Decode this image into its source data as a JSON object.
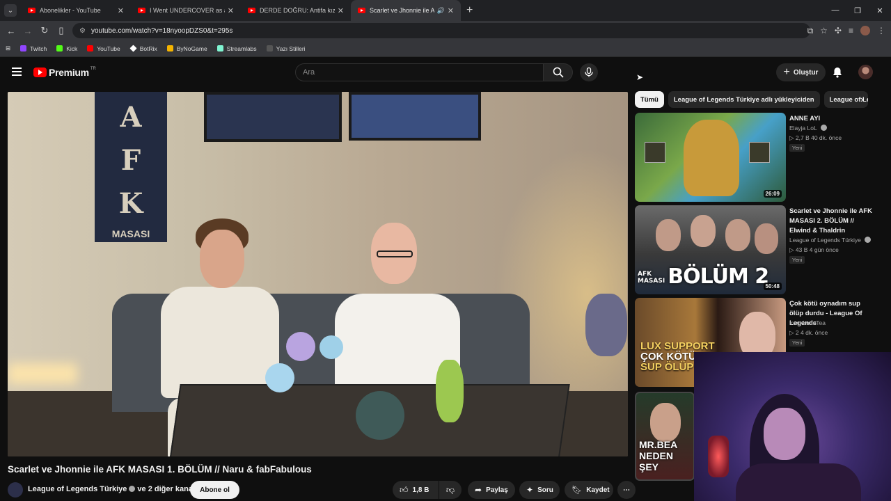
{
  "browser": {
    "tabs": [
      {
        "title": "Abonelikler - YouTube",
        "active": false
      },
      {
        "title": "I Went UNDERCOVER as a Low",
        "active": false
      },
      {
        "title": "DERDE DOĞRU: Antifa kız ve sö",
        "active": false
      },
      {
        "title": "Scarlet ve Jhonnie ile AFK M",
        "active": true
      }
    ],
    "url": "youtube.com/watch?v=18nyoopDZS0&t=295s",
    "bookmarks": [
      {
        "label": "Twitch",
        "color": "#9146ff"
      },
      {
        "label": "Kick",
        "color": "#53fc18"
      },
      {
        "label": "YouTube",
        "color": "#ff0000"
      },
      {
        "label": "BotRix",
        "color": "#ffffff"
      },
      {
        "label": "ByNoGame",
        "color": "#f5b400"
      },
      {
        "label": "Streamlabs",
        "color": "#80f5d2"
      },
      {
        "label": "Yazı Stilleri",
        "color": "#444444"
      }
    ]
  },
  "header": {
    "logo_text": "Premium",
    "region": "TR",
    "search_placeholder": "Ara",
    "create_label": "Oluştur"
  },
  "video": {
    "banner_letters": "A\nF\nK",
    "banner_sub": "MASASI",
    "title": "Scarlet ve Jhonnie ile AFK MASASI 1. BÖLÜM // Naru & fabFabulous",
    "channel": "League of Legends Türkiye",
    "channel_suffix": "ve 2 diğer kanal",
    "subscribe_label": "Abone ol",
    "likes": "1,8 B",
    "share_label": "Paylaş",
    "ask_label": "Soru",
    "save_label": "Kaydet"
  },
  "chips": [
    "Tümü",
    "League of Legends Türkiye adlı yükleyiciden",
    "League of Le"
  ],
  "recommendations": [
    {
      "title": "ANNE AYI",
      "channel": "Elayja LoL",
      "meta": "2,7 B   40 dk. önce",
      "badge": "Yeni",
      "duration": "26:09"
    },
    {
      "title": "Scarlet ve Jhonnie ile AFK MASASI 2. BÖLÜM // Elwind & Thaldrin",
      "channel": "League of Legends Türkiye",
      "meta": "43 B   4 gün önce",
      "badge": "Yeni",
      "duration": "50:48",
      "overlay_small": "AFK\nMASASI",
      "overlay_big": "BÖLÜM 2"
    },
    {
      "title": "Çok kötü oynadım sup ölüp durdu - League Of Legends",
      "channel": "Irem LuneTea",
      "meta": "2   4 dk. önce",
      "badge": "Yeni",
      "overlay_lux1": "LUX SUPPORT",
      "overlay_lux2": "ÇOK KÖTÜ OY",
      "overlay_lux3": "SUP ÖLÜP D"
    },
    {
      "overlay_mr": "MR.BEA",
      "overlay_neden": "NEDEN ŞEY"
    }
  ]
}
